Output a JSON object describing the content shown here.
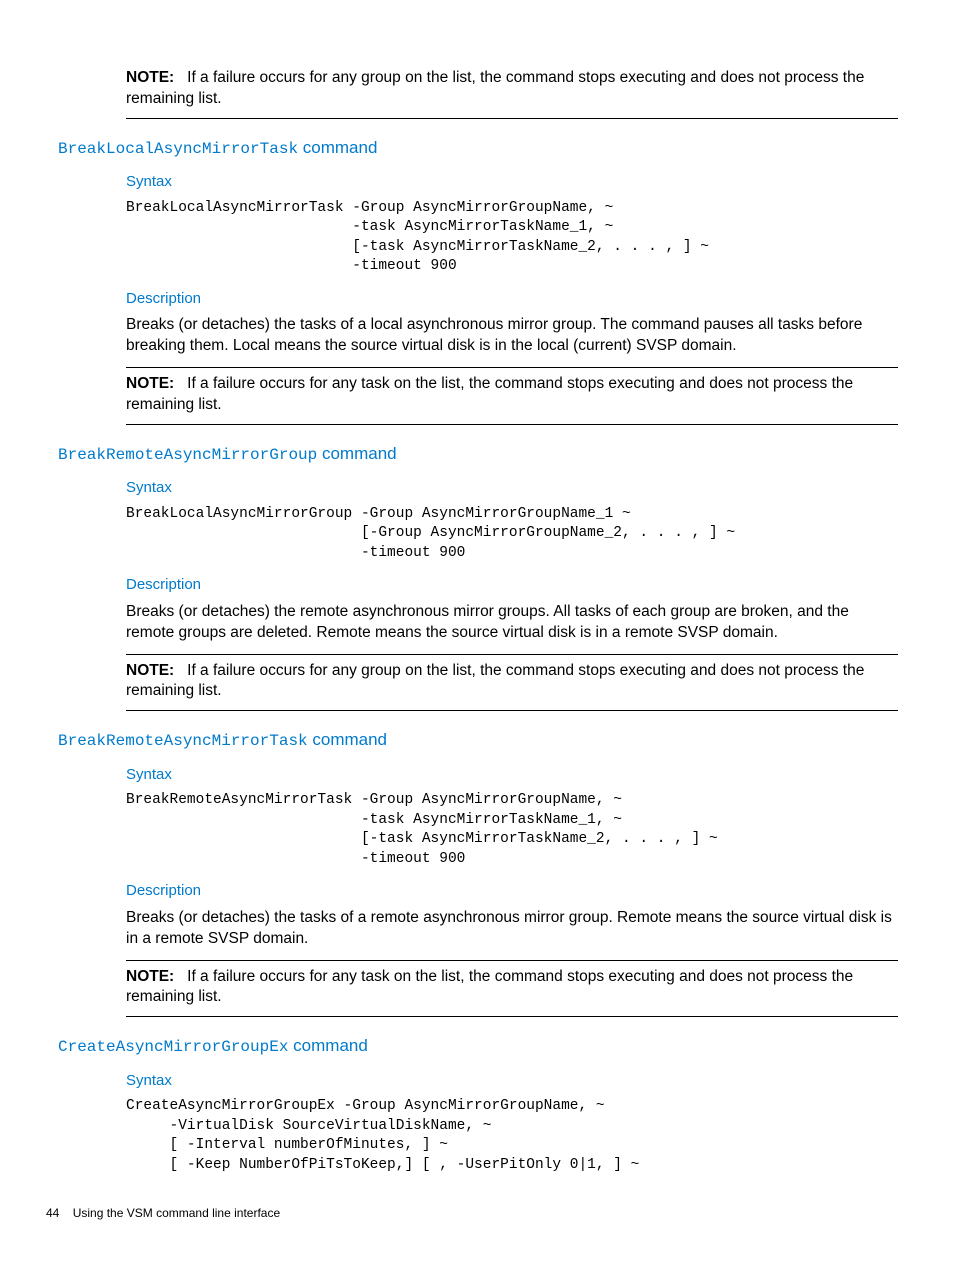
{
  "notes": {
    "top": {
      "label": "NOTE:",
      "text": "If a failure occurs for any group on the list, the command stops executing and does not process the remaining list."
    }
  },
  "sections": [
    {
      "heading_cmd": "BreakLocalAsyncMirrorTask",
      "heading_suffix": " command",
      "syntax_label": "Syntax",
      "syntax_code": "BreakLocalAsyncMirrorTask -Group AsyncMirrorGroupName, ~\n                          -task AsyncMirrorTaskName_1, ~\n                          [-task AsyncMirrorTaskName_2, . . . , ] ~\n                          -timeout 900",
      "desc_label": "Description",
      "desc_text": "Breaks (or detaches) the tasks of a local asynchronous mirror group. The command pauses all tasks before breaking them. Local means the source virtual disk is in the local (current) SVSP domain.",
      "note_label": "NOTE:",
      "note_text": "If a failure occurs for any task on the list, the command stops executing and does not process the remaining list."
    },
    {
      "heading_cmd": "BreakRemoteAsyncMirrorGroup",
      "heading_suffix": " command",
      "syntax_label": "Syntax",
      "syntax_code": "BreakLocalAsyncMirrorGroup -Group AsyncMirrorGroupName_1 ~\n                           [-Group AsyncMirrorGroupName_2, . . . , ] ~\n                           -timeout 900",
      "desc_label": "Description",
      "desc_text": "Breaks (or detaches) the remote asynchronous mirror groups. All tasks of each group are broken, and the remote groups are deleted. Remote means the source virtual disk is in a remote SVSP domain.",
      "note_label": "NOTE:",
      "note_text": "If a failure occurs for any group on the list, the command stops executing and does not process the remaining list."
    },
    {
      "heading_cmd": "BreakRemoteAsyncMirrorTask",
      "heading_suffix": " command",
      "syntax_label": "Syntax",
      "syntax_code": "BreakRemoteAsyncMirrorTask -Group AsyncMirrorGroupName, ~\n                           -task AsyncMirrorTaskName_1, ~\n                           [-task AsyncMirrorTaskName_2, . . . , ] ~\n                           -timeout 900",
      "desc_label": "Description",
      "desc_text": "Breaks (or detaches) the tasks of a remote asynchronous mirror group. Remote means the source virtual disk is in a remote SVSP domain.",
      "note_label": "NOTE:",
      "note_text": "If a failure occurs for any task on the list, the command stops executing and does not process the remaining list."
    },
    {
      "heading_cmd": "CreateAsyncMirrorGroupEx",
      "heading_suffix": " command",
      "syntax_label": "Syntax",
      "syntax_code": "CreateAsyncMirrorGroupEx -Group AsyncMirrorGroupName, ~\n     -VirtualDisk SourceVirtualDiskName, ~\n     [ -Interval numberOfMinutes, ] ~\n     [ -Keep NumberOfPiTsToKeep,] [ , -UserPitOnly 0|1, ] ~"
    }
  ],
  "footer": {
    "page": "44",
    "title": "Using the VSM command line interface"
  }
}
